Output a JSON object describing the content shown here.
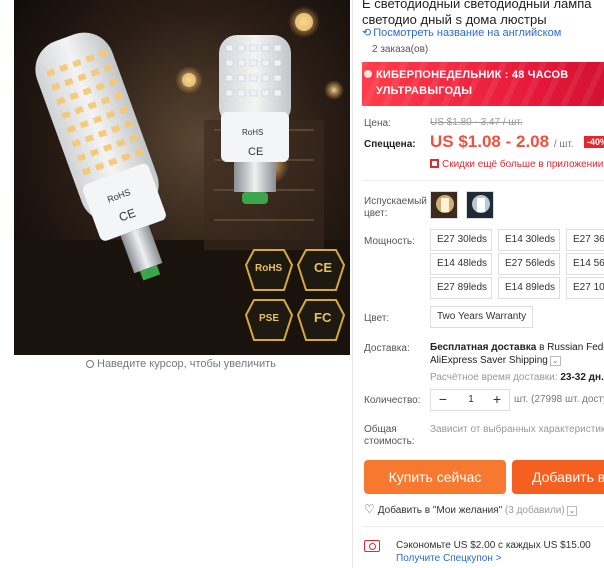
{
  "product": {
    "title_line1": "Е светодиодный светодиодный лампа",
    "title_line2": "светодио дный s дома люстры",
    "translate_link": "Посмотреть название на английском",
    "orders": "2 заказа(ов)"
  },
  "promo": {
    "line1": "КИБЕРПОНЕДЕЛЬНИК : 48 ЧАСОВ",
    "line2": "УЛЬТРАВЫГОДЫ"
  },
  "price": {
    "label_price": "Цена:",
    "old_price": "US $1.80 - 3.47 / шт.",
    "label_special": "Спеццена:",
    "special_price": "US $1.08 - 2.08",
    "per_unit": "/ шт.",
    "discount_badge": "-40%",
    "app_discount": "Скидки ещё больше в приложении"
  },
  "options": {
    "emitted_color_label": "Испускаемый цвет:",
    "power_label": "Мощность:",
    "power_options": [
      "E27 30leds",
      "E14 30leds",
      "E27 36",
      "E14 48leds",
      "E27 56leds",
      "E14 56",
      "E27 89leds",
      "E14 89leds",
      "E27 10"
    ],
    "color_label": "Цвет:",
    "color_value": "Two Years Warranty"
  },
  "shipping": {
    "label": "Доставка:",
    "main_bold": "Бесплатная доставка",
    "main_rest": " в Russian Fede",
    "method": "AliExpress Saver Shipping",
    "time_label": "Расчётное время доставки:",
    "time_value": "23-32 дн."
  },
  "quantity": {
    "label": "Количество:",
    "minus": "−",
    "value": "1",
    "plus": "+",
    "note": "шт. (27998 шт. досту"
  },
  "total": {
    "label": "Общая стоимость:",
    "value": "Зависит от выбранных характеристик"
  },
  "actions": {
    "buy_now": "Купить сейчас",
    "add_to_cart": "Добавить в",
    "wishlist_text": "Добавить в \"Мои желания\"",
    "wishlist_count": "(3 добавили)"
  },
  "coupon": {
    "text": "Сэкономьте US $2.00 с каждых US $15.00",
    "link": "Получите Спецкупон >"
  },
  "gallery": {
    "zoom_hint": "Наведите курсор, чтобы увеличить",
    "cert_rohs": "RoHS",
    "cert_ce": "CE",
    "cert_pse": "PSE",
    "cert_fc": "FC"
  },
  "colors": {
    "accent_orange": "#f7792f",
    "cart_orange": "#f55f20",
    "price_red": "#f0513c",
    "promo_red": "#e5183a",
    "link_blue": "#2a6bd1"
  }
}
